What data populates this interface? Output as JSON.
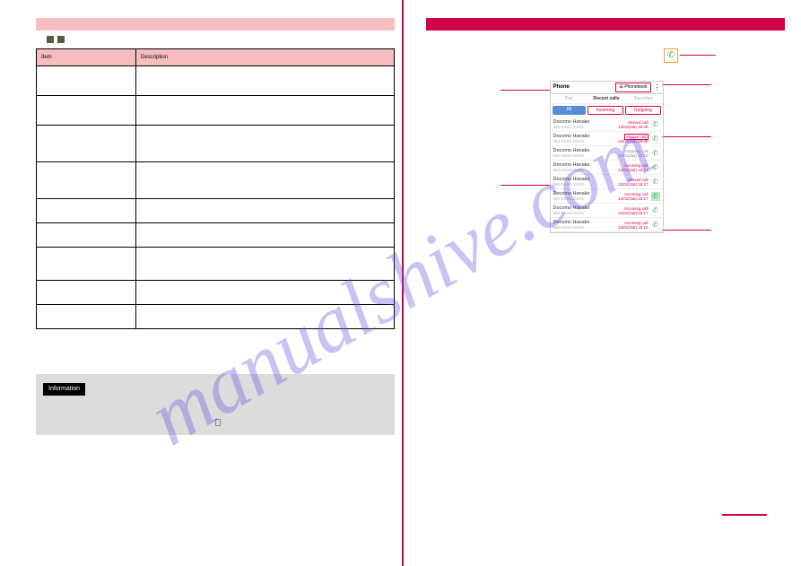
{
  "watermark": "manualshive.com",
  "left": {
    "table_headers": [
      "Item",
      "Description"
    ],
    "rows": [
      [
        "",
        ""
      ],
      [
        "",
        ""
      ],
      [
        "",
        ""
      ],
      [
        "",
        ""
      ],
      [
        "",
        ""
      ],
      [
        "",
        ""
      ],
      [
        "",
        ""
      ],
      [
        "",
        ""
      ],
      [
        "",
        ""
      ]
    ],
    "info_title": "Information",
    "info_body": ""
  },
  "right": {
    "phone_title": "Phone",
    "phonebook_btn": "Phonebook",
    "tabs": {
      "dial": "Dial",
      "recent": "Recent calls",
      "favorites": "Favorites"
    },
    "filters": {
      "all": "All",
      "incoming": "Incoming",
      "outgoing": "Outgoing"
    },
    "calls": [
      {
        "name": "Docomo Hanako",
        "num": "080-XXXX-XXXX",
        "type": "Missed call",
        "time": "12/01(Sat) 18:30",
        "cls": "missed"
      },
      {
        "name": "Docomo Hanako",
        "num": "080-XXXX-XXXX",
        "type": "Missed call",
        "time": "12/01(Sat) 18:25",
        "cls": "missed",
        "boxed": true
      },
      {
        "name": "Docomo Hanako",
        "num": "080-XXXX-XXXX",
        "type": "Outgoing call",
        "time": "12/01(Sat) 18:19",
        "cls": "outgoing"
      },
      {
        "name": "Docomo Hanako",
        "num": "080-XXXX-XXXX",
        "type": "Incoming call",
        "time": "12/01(Sat) 18:17",
        "cls": "incoming"
      },
      {
        "name": "Docomo Hanako",
        "num": "080-XXXX-XXXX",
        "type": "Missed call",
        "time": "12/01(Sat) 18:17",
        "cls": "missed"
      },
      {
        "name": "Docomo Hanako",
        "num": "080-XXXX-XXXX",
        "type": "Incoming call",
        "time": "12/01(Sat) 18:17",
        "cls": "incoming",
        "highlight": true
      },
      {
        "name": "Docomo Hanako",
        "num": "080-XXXX-XXXX",
        "type": "Incoming call",
        "time": "12/01(Sat) 18:17",
        "cls": "incoming"
      },
      {
        "name": "Docomo Hanako",
        "num": "080-XXXX-XXXX",
        "type": "Incoming call",
        "time": "12/01(Sat) 18:16",
        "cls": "incoming"
      }
    ]
  }
}
